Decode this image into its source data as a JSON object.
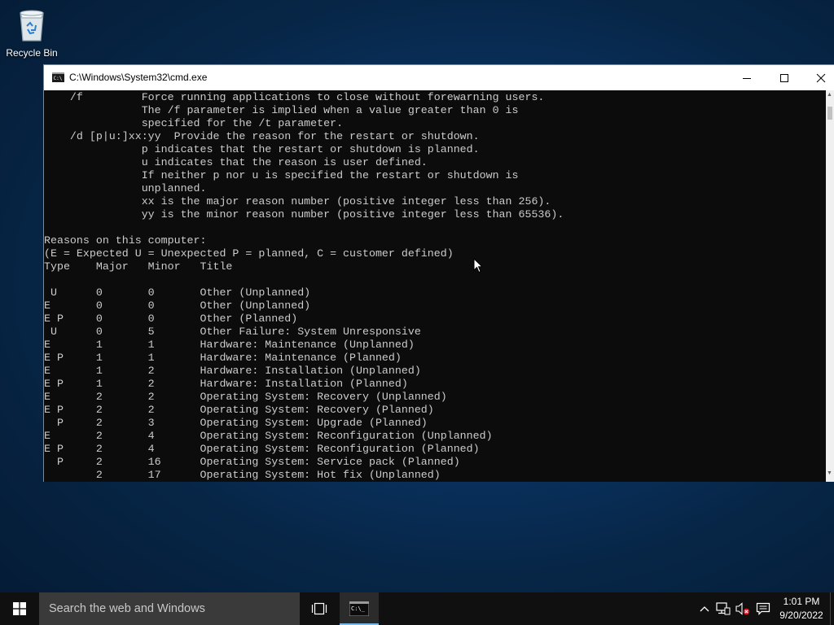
{
  "desktop": {
    "icons": [
      {
        "label": "Recycle Bin"
      }
    ]
  },
  "window": {
    "title": "C:\\Windows\\System32\\cmd.exe",
    "console_lines": [
      "    /f         Force running applications to close without forewarning users.",
      "               The /f parameter is implied when a value greater than 0 is",
      "               specified for the /t parameter.",
      "    /d [p|u:]xx:yy  Provide the reason for the restart or shutdown.",
      "               p indicates that the restart or shutdown is planned.",
      "               u indicates that the reason is user defined.",
      "               If neither p nor u is specified the restart or shutdown is",
      "               unplanned.",
      "               xx is the major reason number (positive integer less than 256).",
      "               yy is the minor reason number (positive integer less than 65536).",
      "",
      "Reasons on this computer:",
      "(E = Expected U = Unexpected P = planned, C = customer defined)",
      "Type    Major   Minor   Title",
      "",
      " U      0       0       Other (Unplanned)",
      "E       0       0       Other (Unplanned)",
      "E P     0       0       Other (Planned)",
      " U      0       5       Other Failure: System Unresponsive",
      "E       1       1       Hardware: Maintenance (Unplanned)",
      "E P     1       1       Hardware: Maintenance (Planned)",
      "E       1       2       Hardware: Installation (Unplanned)",
      "E P     1       2       Hardware: Installation (Planned)",
      "E       2       2       Operating System: Recovery (Unplanned)",
      "E P     2       2       Operating System: Recovery (Planned)",
      "  P     2       3       Operating System: Upgrade (Planned)",
      "E       2       4       Operating System: Reconfiguration (Unplanned)",
      "E P     2       4       Operating System: Reconfiguration (Planned)",
      "  P     2       16      Operating System: Service pack (Planned)",
      "        2       17      Operating System: Hot fix (Unplanned)"
    ]
  },
  "taskbar": {
    "search_placeholder": "Search the web and Windows",
    "clock_time": "1:01 PM",
    "clock_date": "9/20/2022"
  },
  "icons": {
    "start": "windows-logo-icon",
    "task_view": "task-view-icon",
    "tray": [
      "chevron-up-icon",
      "network-icon",
      "volume-muted-icon",
      "notification-icon"
    ]
  },
  "colors": {
    "console_bg": "#0c0c0c",
    "console_fg": "#cccccc",
    "taskbar_bg": "#101010",
    "accent": "#76b9ed"
  }
}
